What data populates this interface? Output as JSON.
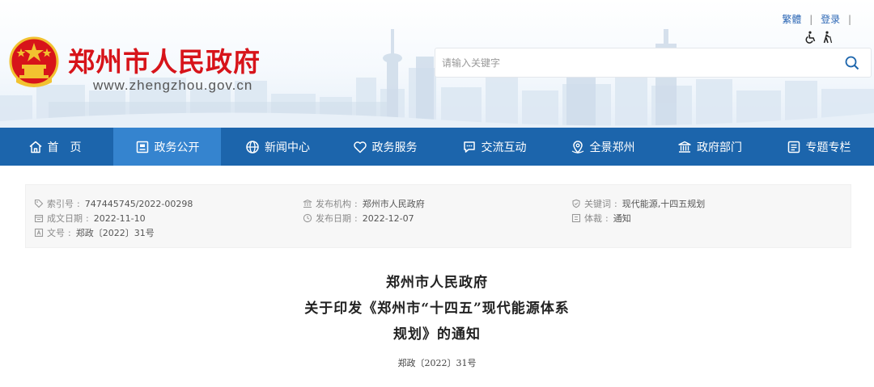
{
  "header": {
    "site_title": "郑州市人民政府",
    "site_url": "www.zhengzhou.gov.cn",
    "top_links": {
      "traditional": "繁體",
      "login": "登录",
      "separator": "|"
    },
    "accessibility_icons": [
      "wheelchair-icon",
      "elderly-icon"
    ],
    "search": {
      "placeholder": "请输入关键字",
      "value": ""
    }
  },
  "nav": {
    "items": [
      {
        "label": "首　页",
        "icon": "home-icon"
      },
      {
        "label": "政务公开",
        "icon": "document-icon",
        "active": true
      },
      {
        "label": "新闻中心",
        "icon": "globe-icon"
      },
      {
        "label": "政务服务",
        "icon": "heart-icon"
      },
      {
        "label": "交流互动",
        "icon": "chat-icon"
      },
      {
        "label": "全景郑州",
        "icon": "location-icon"
      },
      {
        "label": "政府部门",
        "icon": "building-icon"
      },
      {
        "label": "专题专栏",
        "icon": "list-icon"
      }
    ]
  },
  "info": {
    "index_no": {
      "label": "索引号",
      "value": "747445745/2022-00298"
    },
    "issuer": {
      "label": "发布机构",
      "value": "郑州市人民政府"
    },
    "keywords": {
      "label": "关键词",
      "value": "现代能源,十四五规划"
    },
    "created_date": {
      "label": "成文日期",
      "value": "2022-11-10"
    },
    "publish_date": {
      "label": "发布日期",
      "value": "2022-12-07"
    },
    "genre": {
      "label": "体裁",
      "value": "通知"
    },
    "doc_no": {
      "label": "文号",
      "value": "郑政〔2022〕31号"
    },
    "separator": ":"
  },
  "article": {
    "title_lines": [
      "郑州市人民政府",
      "关于印发《郑州市“十四五”现代能源体系",
      "规划》的通知"
    ],
    "doc_number": "郑政〔2022〕31号"
  },
  "colors": {
    "brand_red": "#d7141a",
    "nav_blue": "#1c65ac",
    "nav_active": "#3584cf",
    "link_blue": "#2c67b5"
  }
}
